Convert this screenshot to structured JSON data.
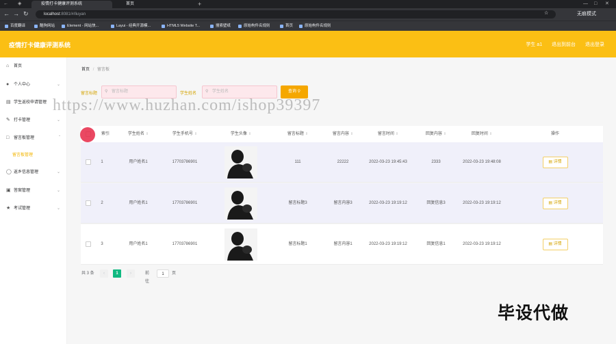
{
  "browser": {
    "tabs": [
      {
        "label": "疫情打卡健康评测系统"
      },
      {
        "label": "首页"
      }
    ],
    "new_tab": "+",
    "url_host": "localhost",
    "url_rest": ":8081/#/liuyan",
    "profile": "无痕模式",
    "bookmarks": [
      "百度翻译",
      "酷狗网站",
      "Element - 网站快...",
      "Layui - 经典开源模...",
      "HTML5 Website T...",
      "搜索壁纸",
      "原始构件名规则",
      "首页",
      "原始构件名规则"
    ]
  },
  "header": {
    "title": "疫情打卡健康评测系统",
    "links": [
      "学生 a1",
      "退出到前台",
      "退出登录"
    ]
  },
  "sidebar": {
    "items": [
      {
        "label": "首页",
        "icon": "home-icon"
      },
      {
        "label": "个人中心",
        "icon": "user-icon"
      },
      {
        "label": "学生返校申请管理",
        "icon": "doc-icon"
      },
      {
        "label": "打卡管理",
        "icon": "check-icon"
      },
      {
        "label": "留言板管理",
        "icon": "message-icon"
      },
      {
        "label": "留言板管理",
        "icon": "",
        "sub": true
      },
      {
        "label": "返乡信息管理",
        "icon": "compass-icon"
      },
      {
        "label": "答案管理",
        "icon": "lock-icon"
      },
      {
        "label": "考试管理",
        "icon": "exam-icon"
      }
    ]
  },
  "breadcrumb": {
    "home": "首页",
    "sep": "/",
    "current": "留言板"
  },
  "search": {
    "label1": "留言标题",
    "placeholder1": "留言标题",
    "label2": "学生姓名",
    "placeholder2": "学生姓名",
    "button": "查询"
  },
  "watermark": "https://www.huzhan.com/ishop39397",
  "table": {
    "headers": [
      "索引",
      "学生姓名",
      "学生手机号",
      "学生头像",
      "留言标题",
      "留言内容",
      "留言时间",
      "回复内容",
      "回复时间",
      "操作"
    ],
    "rows": [
      {
        "index": "1",
        "name": "用户姓名1",
        "phone": "17703786901",
        "title": "111",
        "content": "22222",
        "time": "2022-03-23 19:45:43",
        "reply": "2333",
        "reply_time": "2022-03-23 19:48:08",
        "action": "详情"
      },
      {
        "index": "2",
        "name": "用户姓名1",
        "phone": "17703786901",
        "title": "留言标题3",
        "content": "留言内容3",
        "time": "2022-03-23 19:19:12",
        "reply": "回复信息3",
        "reply_time": "2022-03-23 19:19:12",
        "action": "详情"
      },
      {
        "index": "3",
        "name": "用户姓名1",
        "phone": "17703786901",
        "title": "留言标题1",
        "content": "留言内容1",
        "time": "2022-03-23 19:19:12",
        "reply": "回复信息1",
        "reply_time": "2022-03-23 19:19:12",
        "action": "详情"
      }
    ]
  },
  "pagination": {
    "total": "共 3 条",
    "prev": "‹",
    "page": "1",
    "next": "›",
    "goto": "前往",
    "goto_value": "1",
    "unit": "页"
  },
  "overlay_text": "毕设代做",
  "colors": {
    "accent": "#fbbf14",
    "button": "#f5a700",
    "active_page": "#10b981"
  }
}
